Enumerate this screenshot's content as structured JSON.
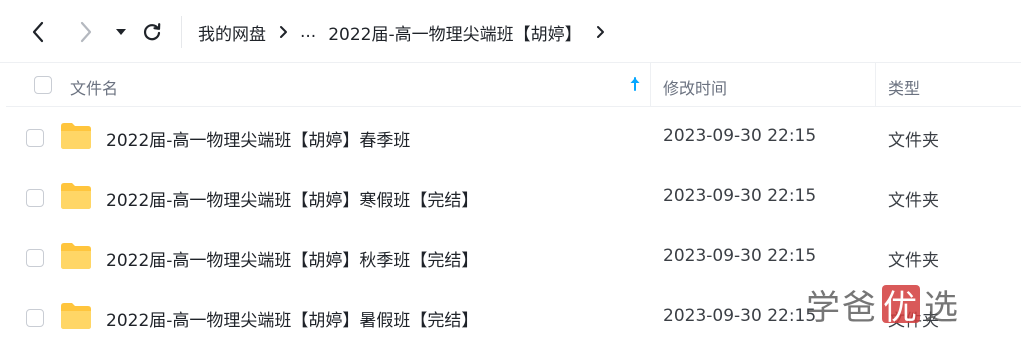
{
  "toolbar": {
    "breadcrumb": {
      "root": "我的网盘",
      "ellipsis": "...",
      "current": "2022届-高一物理尖端班【胡婷】"
    }
  },
  "table": {
    "columns": {
      "name": "文件名",
      "modified": "修改时间",
      "type": "类型"
    },
    "rows": [
      {
        "name": "2022届-高一物理尖端班【胡婷】春季班",
        "modified": "2023-09-30 22:15",
        "type": "文件夹"
      },
      {
        "name": "2022届-高一物理尖端班【胡婷】寒假班【完结】",
        "modified": "2023-09-30 22:15",
        "type": "文件夹"
      },
      {
        "name": "2022届-高一物理尖端班【胡婷】秋季班【完结】",
        "modified": "2023-09-30 22:15",
        "type": "文件夹"
      },
      {
        "name": "2022届-高一物理尖端班【胡婷】暑假班【完结】",
        "modified": "2023-09-30 22:15",
        "type": "文件夹"
      }
    ]
  },
  "watermark": {
    "part1": "学爸",
    "badge": "优",
    "part2": "选"
  },
  "colors": {
    "accent": "#06a7ff",
    "folder": "#ffc53d",
    "text": "#1f2329"
  },
  "icons": [
    "back-arrow-icon",
    "forward-arrow-icon",
    "dropdown-caret-icon",
    "refresh-icon",
    "chevron-right-icon",
    "sort-ascending-icon",
    "folder-icon"
  ]
}
